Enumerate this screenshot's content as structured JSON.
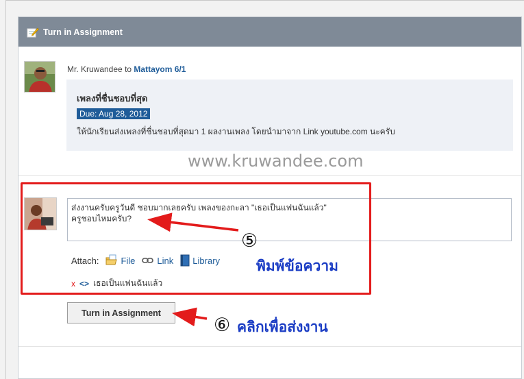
{
  "header": {
    "title": "Turn in Assignment"
  },
  "post": {
    "author": "Mr. Kruwandee",
    "to_word": "to",
    "group": "Mattayom 6/1",
    "title": "เพลงที่ชื่นชอบที่สุด",
    "due": "Due: Aug 28, 2012",
    "body": "ให้นักเรียนส่งเพลงที่ชื่นชอบที่สุดมา 1 ผลงานเพลง โดยนำมาจาก Link youtube.com นะครับ"
  },
  "watermark": "www.kruwandee.com",
  "reply": {
    "message": "ส่งงานครับครูวันดี ชอบมากเลยครับ เพลงของกะลา \"เธอเป็นแฟนฉันแล้ว\"\nครูชอบไหมครับ?",
    "attach_label": "Attach:",
    "attach_file": "File",
    "attach_link": "Link",
    "attach_library": "Library",
    "remove_glyph": "x",
    "linked_glyph": "<>",
    "linked_item": "เธอเป็นแฟนฉันแล้ว",
    "submit_label": "Turn in Assignment"
  },
  "annotations": {
    "step5_number": "⑤",
    "step5_text": "พิมพ์ข้อความ",
    "step6_number": "⑥",
    "step6_text": "คลิกเพื่อส่งงาน",
    "color": "#1a3cc4",
    "highlight_color": "#e31b1b"
  }
}
